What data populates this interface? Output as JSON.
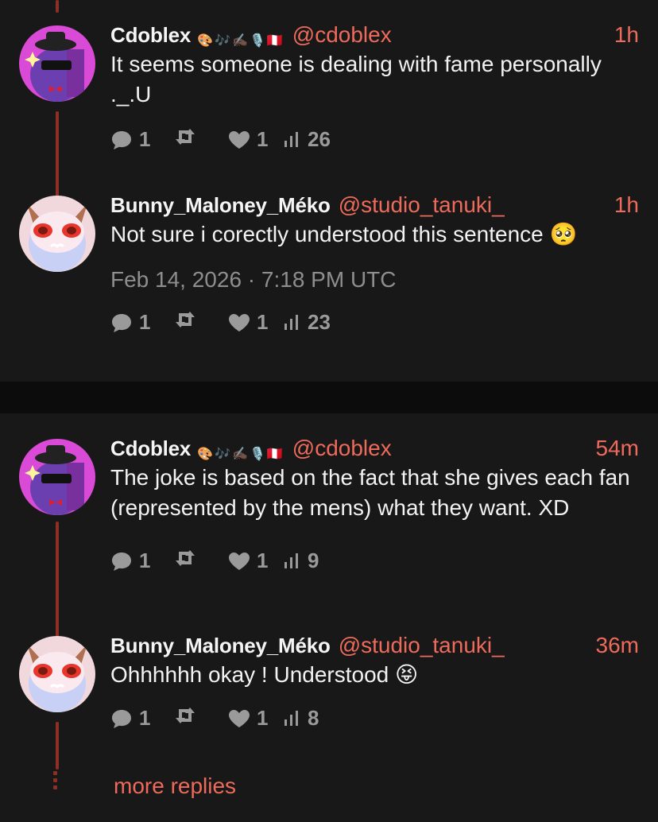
{
  "posts": [
    {
      "name": "Cdoblex",
      "badges": [
        "🎨",
        "🎶",
        "✍🏿",
        "🎙️",
        "🇵🇪"
      ],
      "handle": "@cdoblex",
      "time": "1h",
      "text": "It seems someone is dealing with fame personally ._.U",
      "date": "",
      "replies": "1",
      "likes": "1",
      "views": "26"
    },
    {
      "name": "Bunny_Maloney_Méko",
      "badges": [],
      "handle": "@studio_tanuki_",
      "time": "1h",
      "text": "Not sure i corectly understood this sentence 🥺",
      "date": "Feb 14, 2026 · 7:18 PM UTC",
      "replies": "1",
      "likes": "1",
      "views": "23"
    },
    {
      "name": "Cdoblex",
      "badges": [
        "🎨",
        "🎶",
        "✍🏿",
        "🎙️",
        "🇵🇪"
      ],
      "handle": "@cdoblex",
      "time": "54m",
      "text": "The joke is based on the fact that she gives each fan (represented by the mens) what they want. XD",
      "date": "",
      "replies": "1",
      "likes": "1",
      "views": "9"
    },
    {
      "name": "Bunny_Maloney_Méko",
      "badges": [],
      "handle": "@studio_tanuki_",
      "time": "36m",
      "text": "Ohhhhhh okay ! Understood 😝",
      "date": "",
      "replies": "1",
      "likes": "1",
      "views": "8"
    }
  ],
  "more_replies": "more replies",
  "icons": {
    "reply": "reply-icon",
    "repost": "repost-icon",
    "like": "heart-icon",
    "views": "views-icon"
  },
  "colors": {
    "accent": "#ee6a5b",
    "thread_line": "#8e2f27",
    "background": "#181818",
    "muted": "#9a9a9a"
  }
}
